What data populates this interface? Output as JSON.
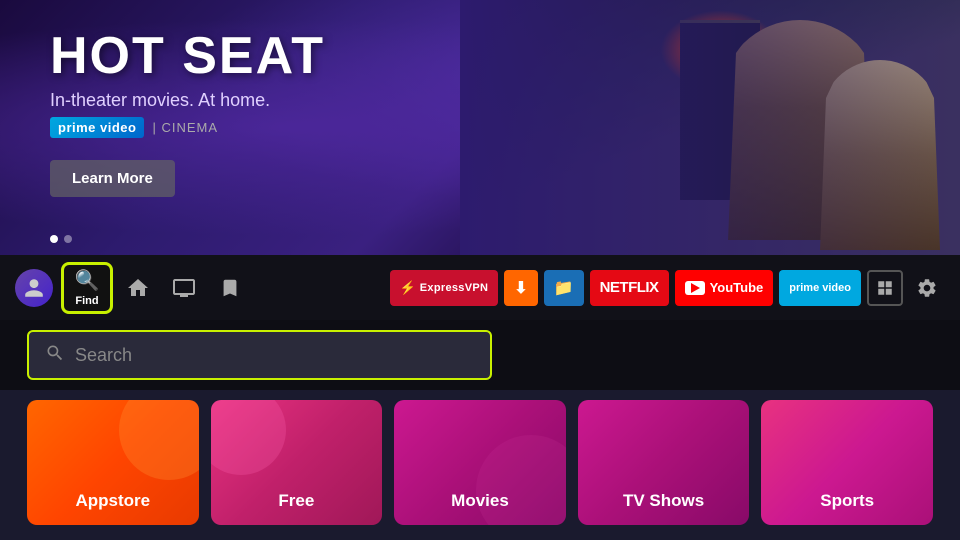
{
  "hero": {
    "title": "HOT SEAT",
    "subtitle": "In-theater movies. At home.",
    "brand": "prime video",
    "brand_separator": "|",
    "cinema": "CINEMA",
    "learn_more_label": "Learn More",
    "dots": [
      {
        "active": true
      },
      {
        "active": false
      }
    ]
  },
  "navbar": {
    "find_label": "Find",
    "nav_items": [
      {
        "icon": "home-icon",
        "label": "Home"
      },
      {
        "icon": "tv-icon",
        "label": "Live"
      },
      {
        "icon": "bookmark-icon",
        "label": "Saved"
      }
    ],
    "apps": [
      {
        "id": "expressvpn",
        "label": "ExpressVPN"
      },
      {
        "id": "downloader",
        "label": "Downloader"
      },
      {
        "id": "filebrowser",
        "label": "FileBrowser"
      },
      {
        "id": "netflix",
        "label": "NETFLIX"
      },
      {
        "id": "youtube",
        "label": "YouTube"
      },
      {
        "id": "primevideo",
        "label": "prime video"
      }
    ]
  },
  "search": {
    "placeholder": "Search"
  },
  "categories": [
    {
      "id": "appstore",
      "label": "Appstore"
    },
    {
      "id": "free",
      "label": "Free"
    },
    {
      "id": "movies",
      "label": "Movies"
    },
    {
      "id": "tvshows",
      "label": "TV Shows"
    },
    {
      "id": "sports",
      "label": "Sports"
    }
  ]
}
